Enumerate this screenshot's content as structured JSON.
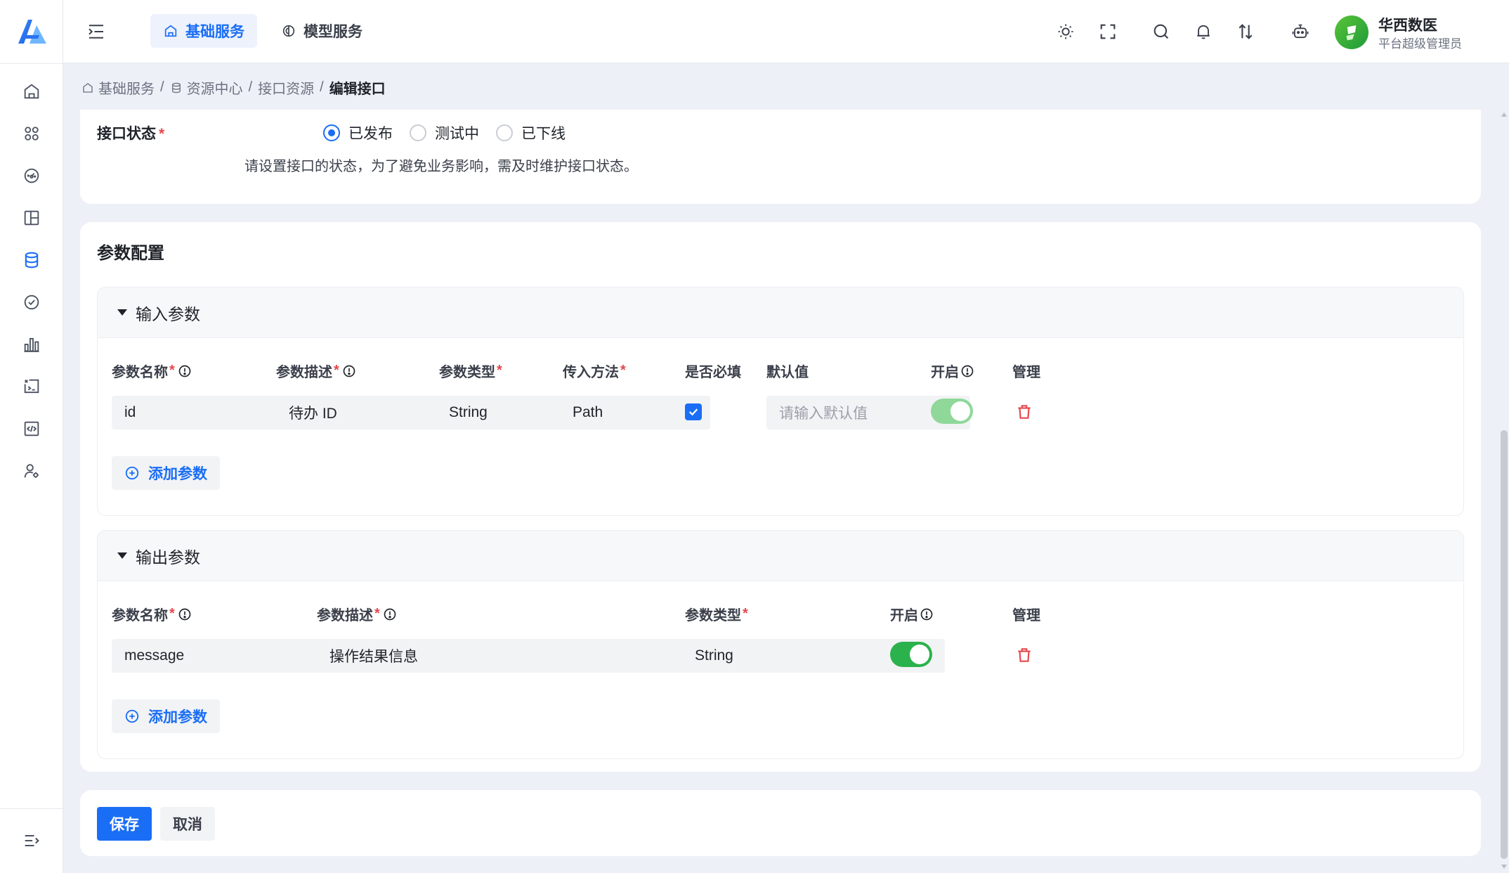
{
  "header": {
    "tabs": [
      {
        "label": "基础服务",
        "active": true,
        "icon": "home-icon"
      },
      {
        "label": "模型服务",
        "active": false,
        "icon": "brain-icon"
      }
    ],
    "user": {
      "name": "华西数医",
      "role": "平台超级管理员"
    }
  },
  "sidebar": {
    "items": [
      "home-icon",
      "apps-icon",
      "dashboard-icon",
      "layout-icon",
      "database-icon",
      "check-circle-icon",
      "bar-chart-icon",
      "terminal-icon",
      "code-icon",
      "user-settings-icon"
    ]
  },
  "breadcrumb": {
    "items": [
      "基础服务",
      "资源中心",
      "接口资源"
    ],
    "current": "编辑接口",
    "separator": "/"
  },
  "status_section": {
    "label": "接口状态",
    "required_mark": "*",
    "options": [
      "已发布",
      "测试中",
      "已下线"
    ],
    "selected": "已发布",
    "hint": "请设置接口的状态，为了避免业务影响，需及时维护接口状态。"
  },
  "params_section": {
    "title": "参数配置",
    "input_params": {
      "title": "输入参数",
      "columns": {
        "name": "参数名称",
        "desc": "参数描述",
        "type": "参数类型",
        "method": "传入方法",
        "required": "是否必填",
        "default": "默认值",
        "enabled": "开启",
        "manage": "管理"
      },
      "row": {
        "name": "id",
        "desc": "待办 ID",
        "type": "String",
        "method": "Path",
        "required": true,
        "default_placeholder": "请输入默认值",
        "enabled": true
      },
      "add_label": "添加参数"
    },
    "output_params": {
      "title": "输出参数",
      "columns": {
        "name": "参数名称",
        "desc": "参数描述",
        "type": "参数类型",
        "enabled": "开启",
        "manage": "管理"
      },
      "row": {
        "name": "message",
        "desc": "操作结果信息",
        "type": "String",
        "enabled": true
      },
      "add_label": "添加参数"
    }
  },
  "footer": {
    "save_label": "保存",
    "cancel_label": "取消"
  },
  "colors": {
    "primary": "#1a6ef5",
    "required": "#e5484d",
    "toggle_on": "#2bb24c",
    "toggle_faded": "#8fd89a",
    "danger": "#e5484d"
  }
}
